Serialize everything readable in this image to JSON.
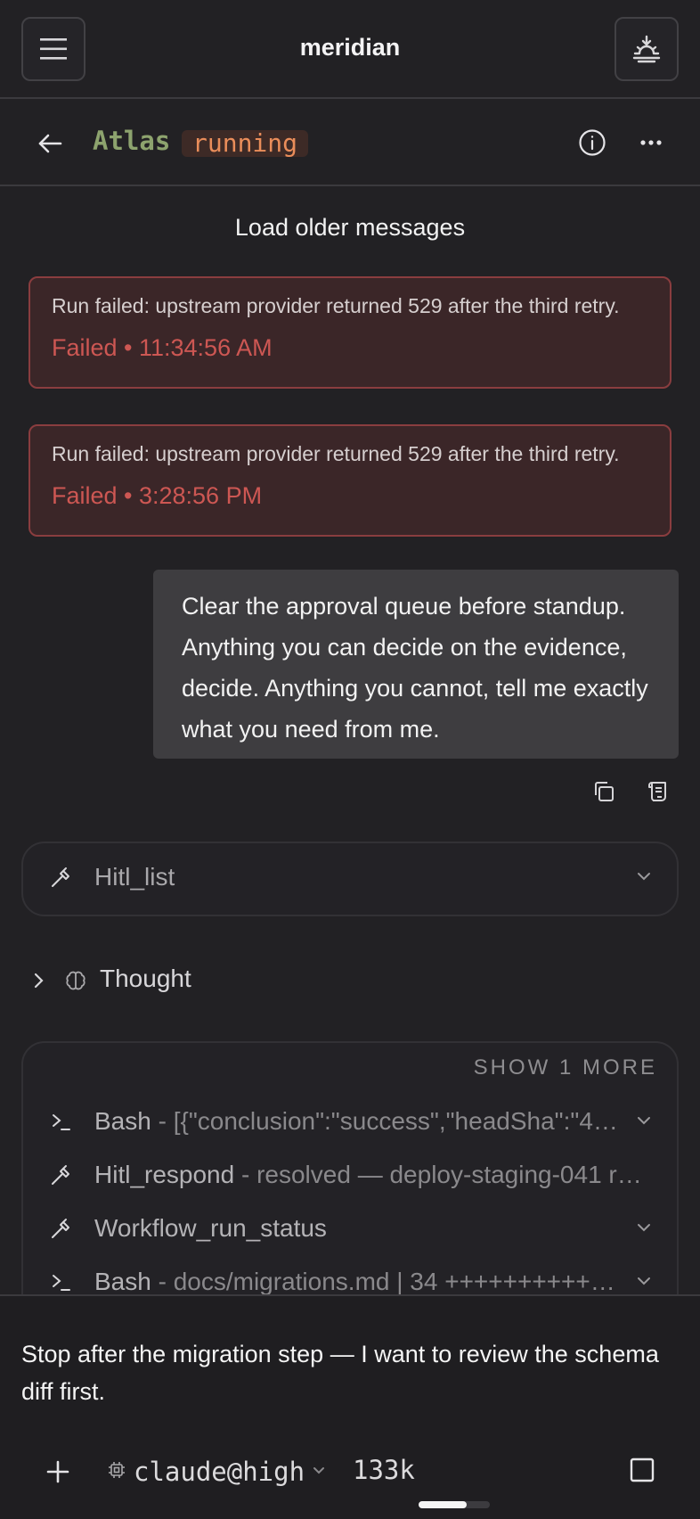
{
  "app": {
    "title": "meridian"
  },
  "agent": {
    "name": "Atlas",
    "status": "running"
  },
  "chat": {
    "load_older": "Load older messages",
    "errors": [
      {
        "message": "Run failed: upstream provider returned 529 after the third retry.",
        "meta": "Failed • 11:34:56 AM"
      },
      {
        "message": "Run failed: upstream provider returned 529 after the third retry.",
        "meta": "Failed • 3:28:56 PM"
      }
    ],
    "user_message": "Clear the approval queue before standup. Anything you can decide on the evidence, decide. Anything you cannot, tell me exactly what you need from me.",
    "tool_single": {
      "name": "Hitl_list"
    },
    "thought": {
      "label": "Thought"
    },
    "tool_group": {
      "show_more": "SHOW 1 MORE",
      "rows": [
        {
          "tool": "Bash",
          "detail": " - [{\"conclusion\":\"success\",\"headSha\":\"4…",
          "icon": "terminal-icon"
        },
        {
          "tool": "Hitl_respond",
          "detail": " - resolved — deploy-staging-041 r…",
          "icon": "hammer-icon"
        },
        {
          "tool": "Workflow_run_status",
          "detail": "",
          "icon": "hammer-icon"
        },
        {
          "tool": "Bash",
          "detail": " - docs/migrations.md | 34 ++++++++++…",
          "icon": "terminal-icon"
        }
      ]
    }
  },
  "composer": {
    "draft": "Stop after the migration step — I want to review the schema diff first.",
    "model": "claude@high",
    "context_tokens": "133k",
    "context_fill": 0.68
  },
  "colors": {
    "accent_green": "#8da36e",
    "status_orange": "#e98d5a",
    "error_red": "#cd5753"
  }
}
